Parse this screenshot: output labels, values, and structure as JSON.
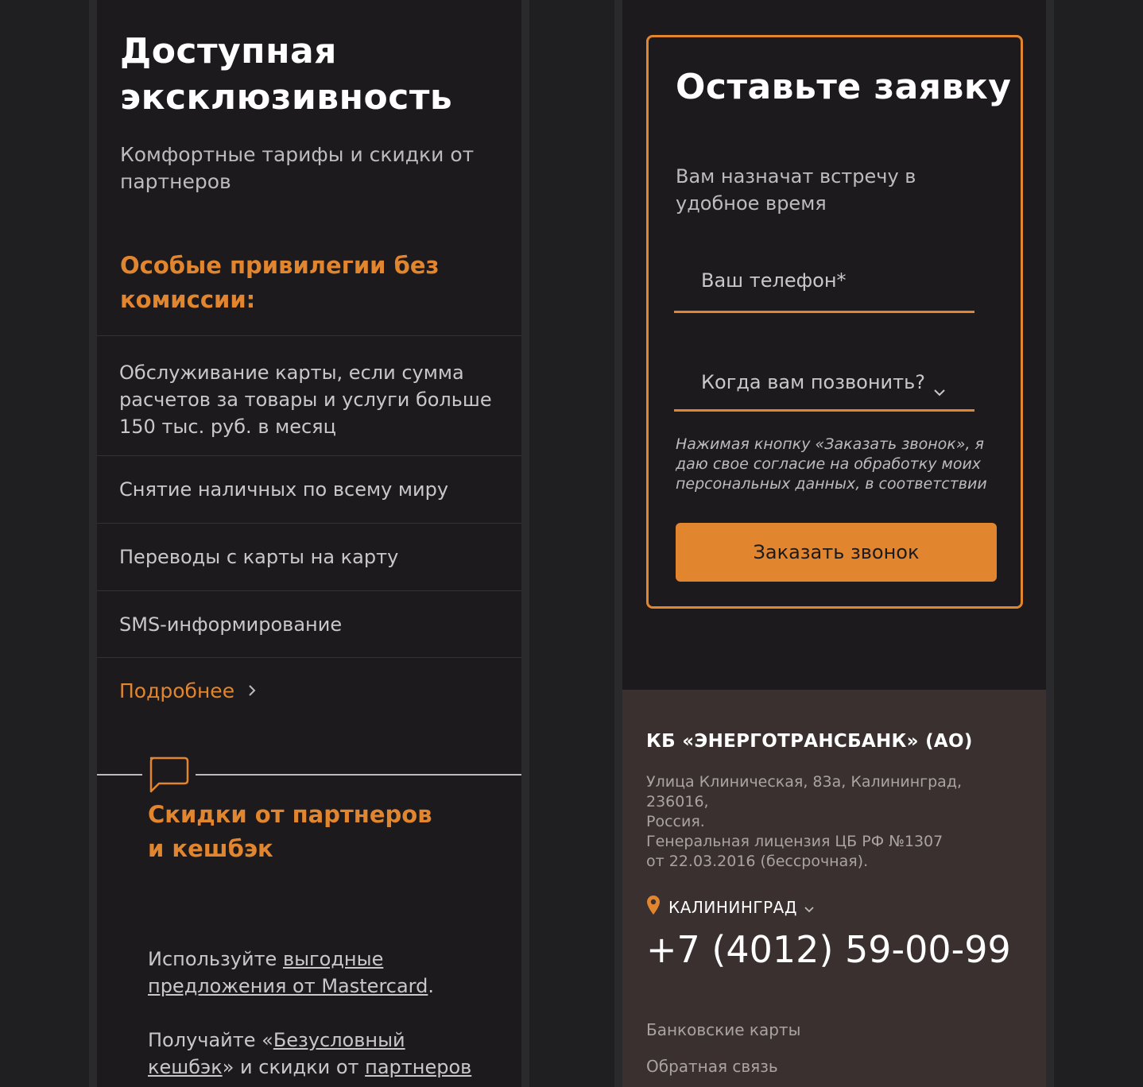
{
  "left": {
    "title": "Доступная эксклюзивность",
    "subtitle": "Комфортные тарифы и скидки от партнеров",
    "privileges_heading": "Особые привилегии без комиссии:",
    "privileges": [
      "Обслуживание карты, если сумма расчетов за товары и услуги больше 150 тыс. руб. в месяц",
      "Снятие наличных по всему миру",
      "Переводы с карты на карту",
      "SMS-информирование"
    ],
    "more_link": "Подробнее",
    "discount_heading": "Скидки от партнеров и кешбэк",
    "para1": {
      "prefix": "Используйте ",
      "link": "выгодные предложения от Mastercard",
      "suffix": "."
    },
    "para2": {
      "prefix": "Получайте «",
      "link1": "Безусловный кешбэк",
      "middle": "» и скидки от ",
      "link2": "партнеров"
    }
  },
  "right": {
    "form": {
      "title": "Оставьте заявку",
      "subtitle": "Вам назначат встречу в удобное время",
      "phone_placeholder": "Ваш телефон*",
      "call_time_label": "Когда вам позвонить?",
      "consent": "Нажимая кнопку «Заказать звонок», я даю свое согласие на обработку моих персональных данных, в соответствии",
      "submit_label": "Заказать звонок"
    },
    "footer": {
      "bank_name": "КБ «ЭНЕРГОТРАНСБАНК» (АО)",
      "address_lines": [
        "Улица Клиническая, 83а, Калининград, 236016,",
        "Россия.",
        "Генеральная лицензия ЦБ РФ №1307",
        "от 22.03.2016 (бессрочная)."
      ],
      "city": "КАЛИНИНГРАД",
      "phone": "+7 (4012) 59-00-99",
      "links": [
        "Банковские карты",
        "Обратная связь"
      ]
    }
  },
  "icons": {
    "chevron_right": "chevron-right-icon",
    "chevron_down": "chevron-down-icon",
    "chat": "chat-bubble-icon",
    "location": "location-pin-icon"
  },
  "colors": {
    "accent": "#e2852f",
    "background": "#1c1a1d",
    "footer_background": "#3a302f",
    "text_light": "#ffffff",
    "text_muted": "#bdbbbe"
  }
}
